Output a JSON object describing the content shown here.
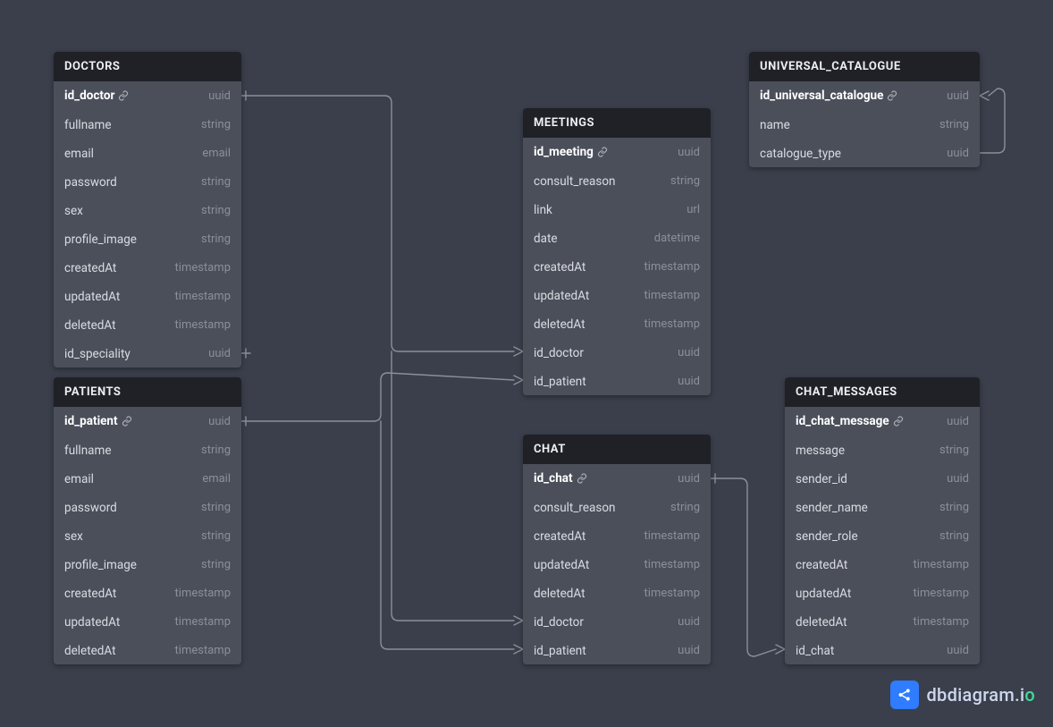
{
  "tables": {
    "doctors": {
      "title": "DOCTORS",
      "cols": [
        {
          "name": "id_doctor",
          "type": "uuid",
          "pk": true
        },
        {
          "name": "fullname",
          "type": "string"
        },
        {
          "name": "email",
          "type": "email"
        },
        {
          "name": "password",
          "type": "string"
        },
        {
          "name": "sex",
          "type": "string"
        },
        {
          "name": "profile_image",
          "type": "string"
        },
        {
          "name": "createdAt",
          "type": "timestamp"
        },
        {
          "name": "updatedAt",
          "type": "timestamp"
        },
        {
          "name": "deletedAt",
          "type": "timestamp"
        },
        {
          "name": "id_speciality",
          "type": "uuid"
        }
      ]
    },
    "patients": {
      "title": "PATIENTS",
      "cols": [
        {
          "name": "id_patient",
          "type": "uuid",
          "pk": true
        },
        {
          "name": "fullname",
          "type": "string"
        },
        {
          "name": "email",
          "type": "email"
        },
        {
          "name": "password",
          "type": "string"
        },
        {
          "name": "sex",
          "type": "string"
        },
        {
          "name": "profile_image",
          "type": "string"
        },
        {
          "name": "createdAt",
          "type": "timestamp"
        },
        {
          "name": "updatedAt",
          "type": "timestamp"
        },
        {
          "name": "deletedAt",
          "type": "timestamp"
        }
      ]
    },
    "meetings": {
      "title": "MEETINGS",
      "cols": [
        {
          "name": "id_meeting",
          "type": "uuid",
          "pk": true
        },
        {
          "name": "consult_reason",
          "type": "string"
        },
        {
          "name": "link",
          "type": "url"
        },
        {
          "name": "date",
          "type": "datetime"
        },
        {
          "name": "createdAt",
          "type": "timestamp"
        },
        {
          "name": "updatedAt",
          "type": "timestamp"
        },
        {
          "name": "deletedAt",
          "type": "timestamp"
        },
        {
          "name": "id_doctor",
          "type": "uuid"
        },
        {
          "name": "id_patient",
          "type": "uuid"
        }
      ]
    },
    "chat": {
      "title": "CHAT",
      "cols": [
        {
          "name": "id_chat",
          "type": "uuid",
          "pk": true
        },
        {
          "name": "consult_reason",
          "type": "string"
        },
        {
          "name": "createdAt",
          "type": "timestamp"
        },
        {
          "name": "updatedAt",
          "type": "timestamp"
        },
        {
          "name": "deletedAt",
          "type": "timestamp"
        },
        {
          "name": "id_doctor",
          "type": "uuid"
        },
        {
          "name": "id_patient",
          "type": "uuid"
        }
      ]
    },
    "catalogue": {
      "title": "UNIVERSAL_CATALOGUE",
      "cols": [
        {
          "name": "id_universal_catalogue",
          "type": "uuid",
          "pk": true
        },
        {
          "name": "name",
          "type": "string"
        },
        {
          "name": "catalogue_type",
          "type": "uuid"
        }
      ]
    },
    "chatmsg": {
      "title": "CHAT_MESSAGES",
      "cols": [
        {
          "name": "id_chat_message",
          "type": "uuid",
          "pk": true
        },
        {
          "name": "message",
          "type": "string"
        },
        {
          "name": "sender_id",
          "type": "uuid"
        },
        {
          "name": "sender_name",
          "type": "string"
        },
        {
          "name": "sender_role",
          "type": "string"
        },
        {
          "name": "createdAt",
          "type": "timestamp"
        },
        {
          "name": "updatedAt",
          "type": "timestamp"
        },
        {
          "name": "deletedAt",
          "type": "timestamp"
        },
        {
          "name": "id_chat",
          "type": "uuid"
        }
      ]
    }
  },
  "watermark": {
    "text": "dbdiagram",
    "suffix": ".io"
  }
}
